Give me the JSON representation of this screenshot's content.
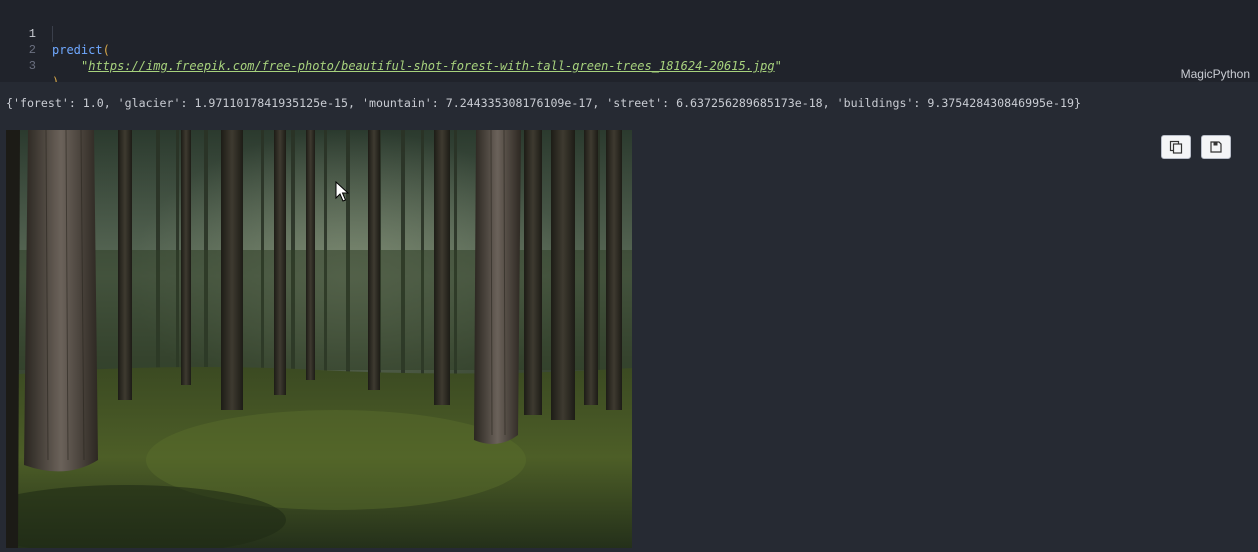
{
  "editor": {
    "lines": [
      {
        "number": "1",
        "fn": "predict",
        "open_paren": "("
      },
      {
        "number": "2",
        "quote_open": "\"",
        "url": "https://img.freepik.com/free-photo/beautiful-shot-forest-with-tall-green-trees_181624-20615.jpg",
        "quote_close": "\""
      },
      {
        "number": "3",
        "close_paren": ")"
      }
    ],
    "language": "MagicPython"
  },
  "output": {
    "text": "{'forest': 1.0, 'glacier': 1.9711017841935125e-15, 'mountain': 7.244335308176109e-17, 'street': 6.637256289685173e-18, 'buildings': 9.375428430846995e-19}",
    "image_description": "forest-photo"
  },
  "toolbar": {
    "copy_icon": "copy-icon",
    "save_icon": "save-icon"
  },
  "colors": {
    "editor_bg": "#20232b",
    "output_bg": "#262a33",
    "function": "#6fa8ff",
    "string": "#a7d27d",
    "paren": "#d7a84a"
  }
}
